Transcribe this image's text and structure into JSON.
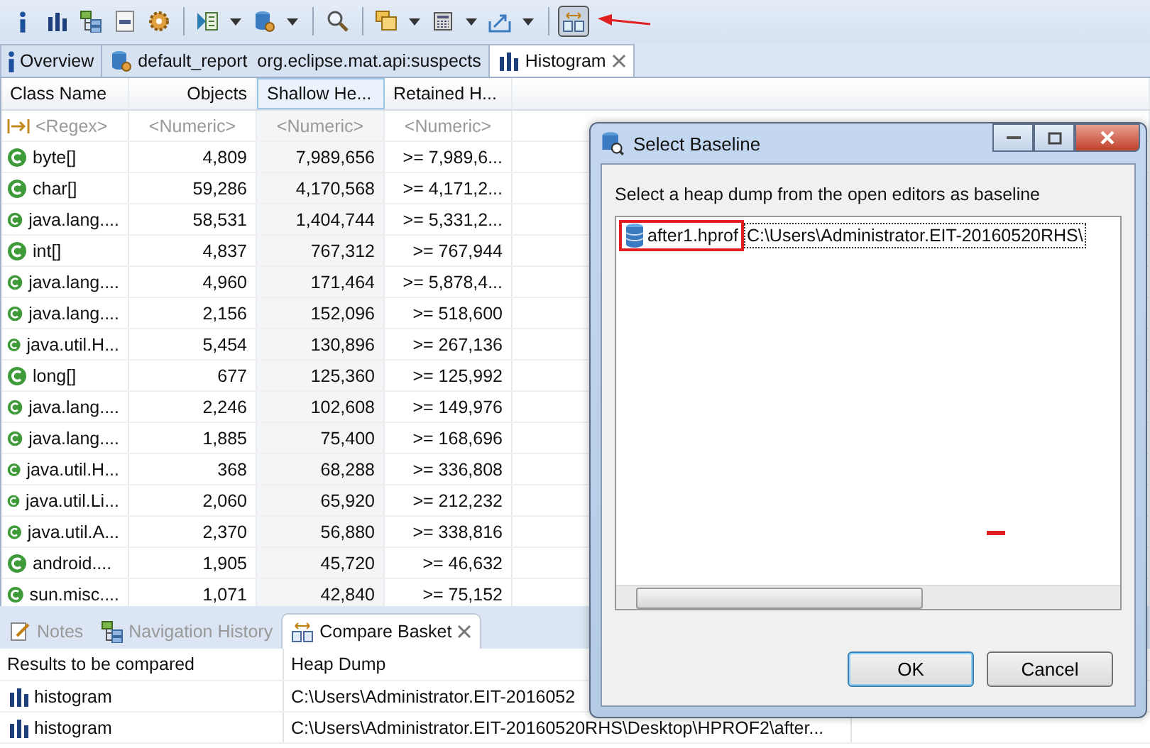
{
  "toolbar": {
    "buttons": [
      {
        "dropdown": false,
        "pressed": false
      },
      {
        "dropdown": false,
        "pressed": false
      },
      {
        "dropdown": false,
        "pressed": false
      },
      {
        "dropdown": false,
        "pressed": false
      },
      {
        "dropdown": false,
        "pressed": false
      },
      {
        "dropdown": true,
        "pressed": false
      },
      {
        "dropdown": true,
        "pressed": false
      },
      {
        "dropdown": false,
        "pressed": false
      },
      {
        "dropdown": true,
        "pressed": false
      },
      {
        "dropdown": true,
        "pressed": false
      },
      {
        "dropdown": true,
        "pressed": false
      },
      {
        "dropdown": false,
        "pressed": true
      }
    ]
  },
  "editor_tabs": [
    {
      "label": "Overview",
      "selected": false,
      "closable": false
    },
    {
      "label": "default_report  org.eclipse.mat.api:suspects",
      "selected": false,
      "closable": false
    },
    {
      "label": "Histogram",
      "selected": true,
      "closable": true
    }
  ],
  "histogram": {
    "columns": [
      {
        "label": "Class Name",
        "sorted": false
      },
      {
        "label": "Objects",
        "sorted": false
      },
      {
        "label": "Shallow He...",
        "sorted": true
      },
      {
        "label": "Retained H...",
        "sorted": false
      }
    ],
    "filters": [
      "<Regex>",
      "<Numeric>",
      "<Numeric>",
      "<Numeric>"
    ],
    "rows": [
      {
        "class_name": "byte[]",
        "objects": "4,809",
        "shallow_heap": "7,989,656",
        "retained_heap": ">= 7,989,6..."
      },
      {
        "class_name": "char[]",
        "objects": "59,286",
        "shallow_heap": "4,170,568",
        "retained_heap": ">= 4,171,2..."
      },
      {
        "class_name": "java.lang....",
        "objects": "58,531",
        "shallow_heap": "1,404,744",
        "retained_heap": ">= 5,331,2..."
      },
      {
        "class_name": "int[]",
        "objects": "4,837",
        "shallow_heap": "767,312",
        "retained_heap": ">= 767,944"
      },
      {
        "class_name": "java.lang....",
        "objects": "4,960",
        "shallow_heap": "171,464",
        "retained_heap": ">= 5,878,4..."
      },
      {
        "class_name": "java.lang....",
        "objects": "2,156",
        "shallow_heap": "152,096",
        "retained_heap": ">= 518,600"
      },
      {
        "class_name": "java.util.H...",
        "objects": "5,454",
        "shallow_heap": "130,896",
        "retained_heap": ">= 267,136"
      },
      {
        "class_name": "long[]",
        "objects": "677",
        "shallow_heap": "125,360",
        "retained_heap": ">= 125,992"
      },
      {
        "class_name": "java.lang....",
        "objects": "2,246",
        "shallow_heap": "102,608",
        "retained_heap": ">= 149,976"
      },
      {
        "class_name": "java.lang....",
        "objects": "1,885",
        "shallow_heap": "75,400",
        "retained_heap": ">= 168,696"
      },
      {
        "class_name": "java.util.H...",
        "objects": "368",
        "shallow_heap": "68,288",
        "retained_heap": ">= 336,808"
      },
      {
        "class_name": "java.util.Li...",
        "objects": "2,060",
        "shallow_heap": "65,920",
        "retained_heap": ">= 212,232"
      },
      {
        "class_name": "java.util.A...",
        "objects": "2,370",
        "shallow_heap": "56,880",
        "retained_heap": ">= 338,816"
      },
      {
        "class_name": "android....",
        "objects": "1,905",
        "shallow_heap": "45,720",
        "retained_heap": ">= 46,632"
      },
      {
        "class_name": "sun.misc....",
        "objects": "1,071",
        "shallow_heap": "42,840",
        "retained_heap": ">= 75,152"
      }
    ]
  },
  "bottom_panel": {
    "tabs": [
      {
        "label": "Notes",
        "selected": false,
        "closable": false
      },
      {
        "label": "Navigation History",
        "selected": false,
        "closable": false
      },
      {
        "label": "Compare Basket",
        "selected": true,
        "closable": true
      }
    ],
    "columns": [
      "Results to be compared",
      "Heap Dump"
    ],
    "rows": [
      {
        "result": "histogram",
        "heap_dump": "C:\\Users\\Administrator.EIT-2016052"
      },
      {
        "result": "histogram",
        "heap_dump": "C:\\Users\\Administrator.EIT-20160520RHS\\Desktop\\HPROF2\\after..."
      }
    ]
  },
  "dialog": {
    "title": "Select Baseline",
    "prompt": "Select a heap dump from the open editors as baseline",
    "items": [
      {
        "name": "after1.hprof",
        "path": "C:\\Users\\Administrator.EIT-20160520RHS\\",
        "highlighted": true
      }
    ],
    "buttons": [
      {
        "label": "OK",
        "default": true
      },
      {
        "label": "Cancel",
        "default": false
      }
    ]
  }
}
